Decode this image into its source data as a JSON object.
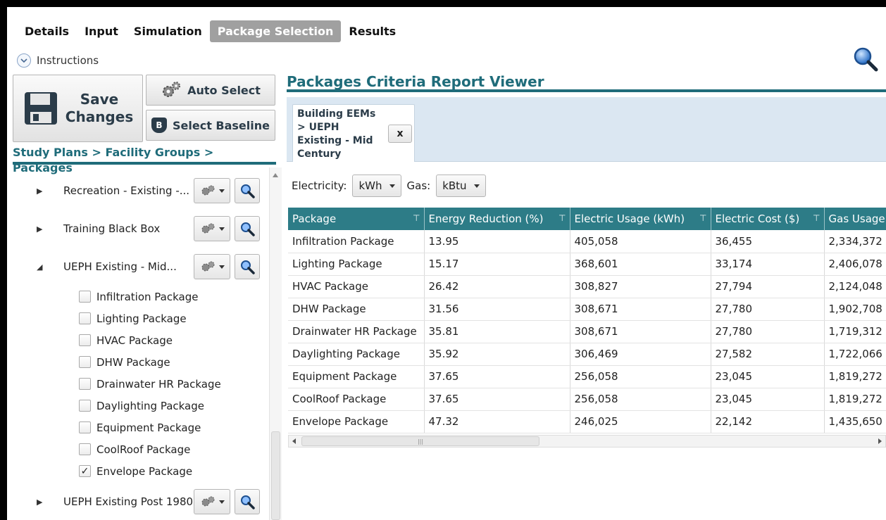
{
  "top_tabs": [
    "Details",
    "Input",
    "Simulation",
    "Package Selection",
    "Results"
  ],
  "active_tab": "Package Selection",
  "instructions_label": "Instructions",
  "toolbar": {
    "save_label_1": "Save",
    "save_label_2": "Changes",
    "auto_select_label": "Auto Select",
    "select_baseline_label": "Select Baseline",
    "baseline_badge": "B"
  },
  "breadcrumb": "Study Plans > Facility Groups > Packages",
  "tree": {
    "groups": [
      {
        "name": "Recreation - Existing -...",
        "expanded": false
      },
      {
        "name": "Training Black Box",
        "expanded": false
      },
      {
        "name": "UEPH Existing - Mid...",
        "expanded": true
      },
      {
        "name": "UEPH Existing Post 1980",
        "expanded": false
      }
    ],
    "packages": [
      {
        "label": "Infiltration Package",
        "checked": false
      },
      {
        "label": "Lighting Package",
        "checked": false
      },
      {
        "label": "HVAC Package",
        "checked": false
      },
      {
        "label": "DHW Package",
        "checked": false
      },
      {
        "label": "Drainwater HR Package",
        "checked": false
      },
      {
        "label": "Daylighting Package",
        "checked": false
      },
      {
        "label": "Equipment Package",
        "checked": false
      },
      {
        "label": "CoolRoof Package",
        "checked": false
      },
      {
        "label": "Envelope Package",
        "checked": true
      }
    ]
  },
  "viewer": {
    "title": "Packages Criteria Report Viewer",
    "doc_tab_lines": [
      "Building EEMs",
      "> UEPH",
      "Existing - Mid",
      "Century"
    ],
    "close_label": "x"
  },
  "units": {
    "electricity_label": "Electricity:",
    "electricity_value": "kWh",
    "gas_label": "Gas:",
    "gas_value": "kBtu"
  },
  "grid": {
    "columns": [
      "Package",
      "Energy Reduction (%)",
      "Electric Usage (kWh)",
      "Electric Cost ($)",
      "Gas Usage"
    ],
    "rows": [
      [
        "Infiltration Package",
        "13.95",
        "405,058",
        "36,455",
        "2,334,372"
      ],
      [
        "Lighting Package",
        "15.17",
        "368,601",
        "33,174",
        "2,406,078"
      ],
      [
        "HVAC Package",
        "26.42",
        "308,827",
        "27,794",
        "2,124,048"
      ],
      [
        "DHW Package",
        "31.56",
        "308,671",
        "27,780",
        "1,902,708"
      ],
      [
        "Drainwater HR Package",
        "35.81",
        "308,671",
        "27,780",
        "1,719,312"
      ],
      [
        "Daylighting Package",
        "35.92",
        "306,469",
        "27,582",
        "1,722,066"
      ],
      [
        "Equipment Package",
        "37.65",
        "256,058",
        "23,045",
        "1,819,272"
      ],
      [
        "CoolRoof Package",
        "37.65",
        "256,058",
        "23,045",
        "1,819,272"
      ],
      [
        "Envelope Package",
        "47.32",
        "246,025",
        "22,142",
        "1,435,650"
      ]
    ]
  },
  "colors": {
    "accent": "#1f6c7a",
    "header_bg": "#2d7c87",
    "tab_strip": "#dbe7f2"
  }
}
